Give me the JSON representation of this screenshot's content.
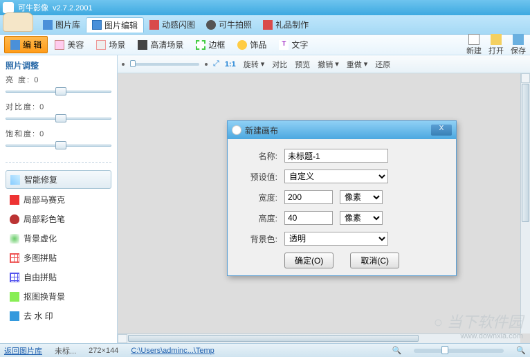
{
  "titlebar": {
    "app": "可牛影像",
    "version": "v2.7.2.2001"
  },
  "maintabs": {
    "library": "图片库",
    "edit": "图片编辑",
    "flash": "动感闪图",
    "camera": "可牛拍照",
    "gift": "礼品制作"
  },
  "subtabs": {
    "edit": "编 辑",
    "beauty": "美容",
    "scene": "场景",
    "hd": "高清场景",
    "border": "边框",
    "decor": "饰品",
    "text": "文字"
  },
  "toolbar_right": {
    "new": "新建",
    "open": "打开",
    "save": "保存"
  },
  "adjust": {
    "header": "照片调整",
    "brightness": {
      "label": "亮 度:",
      "value": "0"
    },
    "contrast": {
      "label": "对比度:",
      "value": "0"
    },
    "saturation": {
      "label": "饱和度:",
      "value": "0"
    }
  },
  "tools": {
    "smartfix": "智能修复",
    "mosaic": "局部马赛克",
    "brush": "局部彩色笔",
    "blur": "背景虚化",
    "collage": "多图拼贴",
    "freecollage": "自由拼贴",
    "cutout": "抠图换背景",
    "watermark": "去 水 印"
  },
  "canvastb": {
    "ratio": "1:1",
    "rotate": "旋转",
    "compare": "对比",
    "preview": "预览",
    "undo": "撤销",
    "redo": "重做",
    "restore": "还原"
  },
  "dialog": {
    "title": "新建画布",
    "name_label": "名称:",
    "name_value": "未标题-1",
    "preset_label": "预设值:",
    "preset_value": "自定义",
    "width_label": "宽度:",
    "width_value": "200",
    "height_label": "高度:",
    "height_value": "40",
    "unit": "像素",
    "bg_label": "背景色:",
    "bg_value": "透明",
    "ok": "确定(O)",
    "cancel": "取消(C)"
  },
  "status": {
    "back": "返回图片库",
    "untitled": "未标...",
    "dims": "272×144",
    "path": "C:\\Users\\adminc...\\Temp"
  },
  "watermark": {
    "name": "当下软件园",
    "url": "www.downxia.com"
  }
}
